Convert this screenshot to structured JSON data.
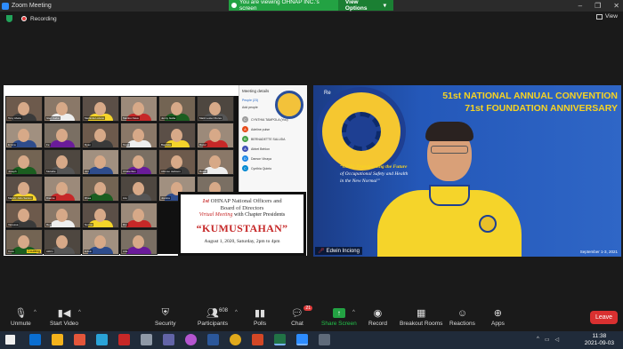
{
  "window": {
    "title": "Zoom Meeting"
  },
  "share_bar": {
    "message": "You are viewing OHNAP INC.'s screen",
    "view_options": "View Options"
  },
  "status": {
    "recording": "Recording",
    "view": "View"
  },
  "shared_screen": {
    "panel_title": "Meeting details",
    "panel_tabs": [
      "People (23)",
      "Add people"
    ],
    "panel_people": [
      {
        "initial": "C",
        "name": "CYNTHIA TAMPOLA (You)",
        "color": "#9e9e9e"
      },
      {
        "initial": "A",
        "name": "Adeline pulse",
        "color": "#e64a19"
      },
      {
        "initial": "B",
        "name": "BERNADETTE SALUDA",
        "color": "#43a047"
      },
      {
        "initial": "A",
        "name": "Abbet Behlon",
        "color": "#3f51b5"
      },
      {
        "initial": "D",
        "name": "Damon Vinaya",
        "color": "#1e88e5"
      },
      {
        "initial": "C",
        "name": "Cynthia Quinto",
        "color": "#0288d1"
      }
    ],
    "tile_labels": [
      "Tony Abela",
      "Glen Gaba",
      "Merlinda Lozano",
      "Marilou Nava",
      "Jenny Gaba",
      "Mark Lester Flores",
      "Emma",
      "Fe",
      "Ryan",
      "Tonet",
      "Bautista",
      "Racel",
      "Joseph",
      "Melodie",
      "Jon",
      "Chatterbox",
      "Alfonso Jackson",
      "Rosal",
      "Marivic Julio Santos",
      "Dianne",
      "Rhea",
      "Lito",
      "Joanna",
      "Lorna",
      "Vanessa",
      "Rex",
      "Norma",
      "Rio",
      "Cess",
      "Aldrin",
      "Edwin",
      "Lilia"
    ],
    "yellow_tags": [
      "Doubling"
    ],
    "banner": {
      "ordinal": "1st",
      "line1": "OHNAP National Officers and",
      "line2": "Board of Directors",
      "line3_italic": "Virtual Meeting",
      "line3_rest": "with Chapter Presidents",
      "headline": "“KUMUSTAHAN”",
      "date": "August 1, 2020, Saturday, 2pm to 4pm"
    }
  },
  "speaker_video": {
    "name": "Edwin Inciong",
    "recording_tag": "Re",
    "convention_line1": "51st NATIONAL ANNUAL CONVENTION",
    "convention_line2": "71st FOUNDATION ANNIVERSARY",
    "theme_label": "“OHN: Transforming the Future",
    "theme_line2": "of Occupational Safety and Health",
    "theme_line3": "in the New Normal”",
    "date_range": "September 1-3, 2021"
  },
  "toolbar": {
    "unmute": "Unmute",
    "start_video": "Start Video",
    "security": "Security",
    "participants": "Participants",
    "participants_count": "608",
    "polls": "Polls",
    "chat": "Chat",
    "chat_badge": "21",
    "share_screen": "Share Screen",
    "record": "Record",
    "breakout_rooms": "Breakout Rooms",
    "reactions": "Reactions",
    "apps": "Apps",
    "leave": "Leave"
  },
  "taskbar": {
    "time": "11:38",
    "date": "2021-09-03"
  },
  "colors": {
    "accent_green": "#23a243",
    "leave_red": "#d93030",
    "convention_yellow": "#f6d323"
  }
}
